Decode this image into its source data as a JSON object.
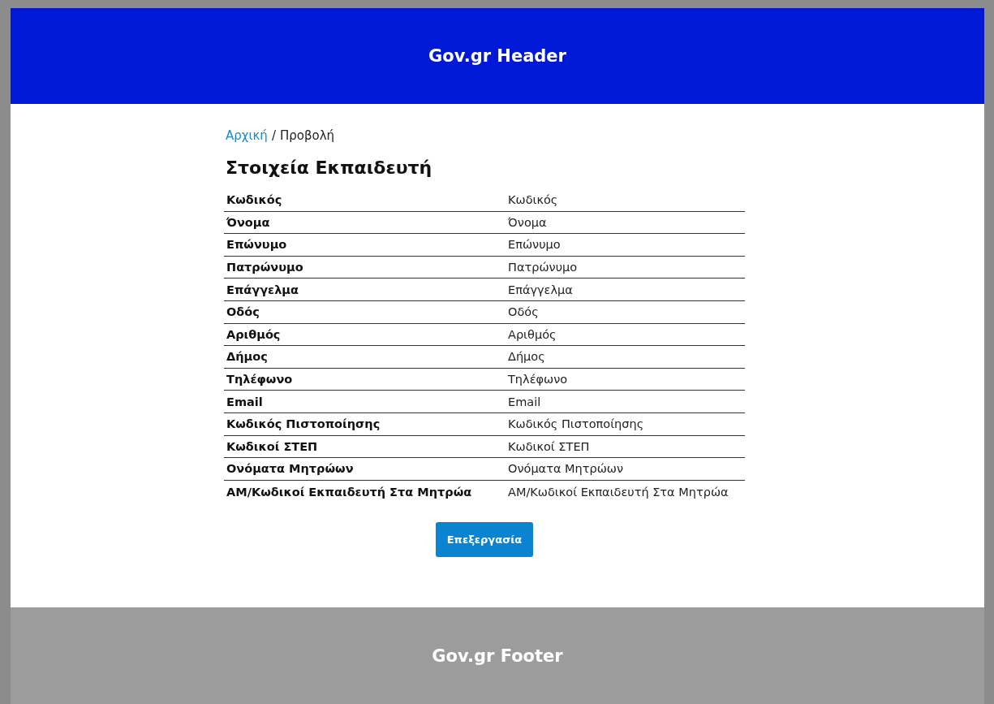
{
  "header": {
    "title": "Gov.gr Header"
  },
  "breadcrumb": [
    {
      "label": "Αρχική",
      "kind": "link"
    },
    {
      "label": "Προβολή",
      "kind": "current"
    }
  ],
  "breadcrumb_separator": "/",
  "heading": "Στοιχεία Εκπαιδευτή",
  "table": {
    "rows": [
      {
        "label": "Κωδικός",
        "value": "Κωδικός"
      },
      {
        "label": "Όνομα",
        "value": "Όνομα"
      },
      {
        "label": "Επώνυμο",
        "value": "Επώνυμο"
      },
      {
        "label": "Πατρώνυμο",
        "value": "Πατρώνυμο"
      },
      {
        "label": "Επάγγελμα",
        "value": "Επάγγελμα"
      },
      {
        "label": "Οδός",
        "value": "Οδός"
      },
      {
        "label": "Αριθμός",
        "value": "Αριθμός"
      },
      {
        "label": "Δήμος",
        "value": "Δήμος"
      },
      {
        "label": "Τηλέφωνο",
        "value": "Τηλέφωνο"
      },
      {
        "label": "Email",
        "value": "Email"
      },
      {
        "label": "Κωδικός Πιστοποίησης",
        "value": "Κωδικός Πιστοποίησης"
      },
      {
        "label": "Κωδικοί ΣΤΕΠ",
        "value": "Κωδικοί ΣΤΕΠ"
      },
      {
        "label": "Ονόματα Μητρώων",
        "value": "Ονόματα Μητρώων"
      },
      {
        "label": "ΑΜ/Κωδικοί Εκπαιδευτή Στα Μητρώα",
        "value": "ΑΜ/Κωδικοί Εκπαιδευτή Στα Μητρώα"
      }
    ]
  },
  "edit_button": "Επεξεργασία",
  "footer": {
    "title": "Gov.gr Footer"
  }
}
